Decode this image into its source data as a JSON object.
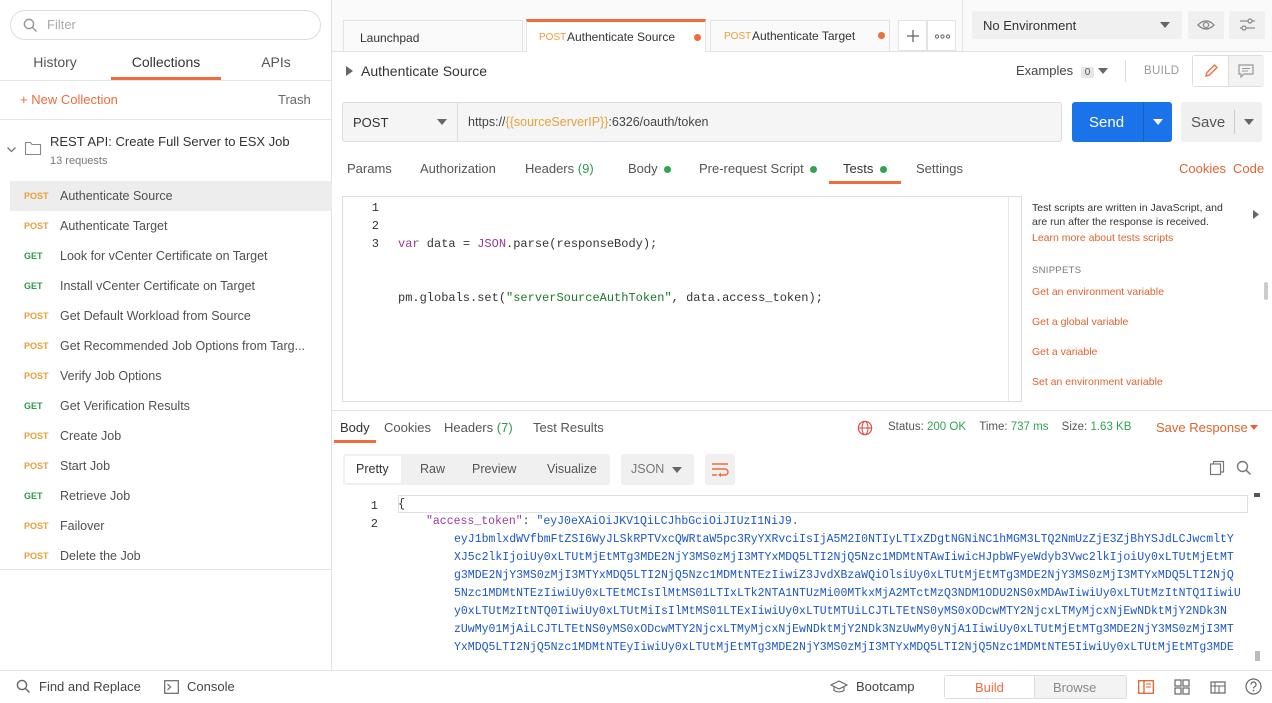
{
  "sidebar": {
    "filter_placeholder": "Filter",
    "tabs": [
      "History",
      "Collections",
      "APIs"
    ],
    "new_collection": "+ New Collection",
    "trash": "Trash",
    "collection": {
      "name": "REST API: Create Full Server to ESX Job",
      "count": "13 requests"
    },
    "requests": [
      {
        "method": "POST",
        "name": "Authenticate Source"
      },
      {
        "method": "POST",
        "name": "Authenticate Target"
      },
      {
        "method": "GET",
        "name": "Look for vCenter Certificate on Target"
      },
      {
        "method": "GET",
        "name": "Install vCenter Certificate on Target"
      },
      {
        "method": "POST",
        "name": "Get Default Workload from Source"
      },
      {
        "method": "POST",
        "name": "Get Recommended Job Options from Targ..."
      },
      {
        "method": "POST",
        "name": "Verify Job Options"
      },
      {
        "method": "GET",
        "name": "Get Verification Results"
      },
      {
        "method": "POST",
        "name": "Create Job"
      },
      {
        "method": "POST",
        "name": "Start Job"
      },
      {
        "method": "GET",
        "name": "Retrieve Job"
      },
      {
        "method": "POST",
        "name": "Failover"
      },
      {
        "method": "POST",
        "name": "Delete the Job"
      }
    ]
  },
  "tabs": {
    "launchpad": "Launchpad",
    "tab1": {
      "method": "POST",
      "name": "Authenticate Source"
    },
    "tab2": {
      "method": "POST",
      "name": "Authenticate Target"
    }
  },
  "environment": {
    "selected": "No Environment"
  },
  "request": {
    "title": "Authenticate Source",
    "examples_label": "Examples",
    "examples_count": "0",
    "build_label": "BUILD",
    "method": "POST",
    "url_prefix": "https://",
    "url_var": "{{sourceServerIP}}",
    "url_suffix": ":6326/oauth/token",
    "send": "Send",
    "save": "Save",
    "tabs": {
      "params": "Params",
      "authorization": "Authorization",
      "headers": "Headers",
      "headers_count": "(9)",
      "body": "Body",
      "prerequest": "Pre-request Script",
      "tests": "Tests",
      "settings": "Settings"
    },
    "cookies": "Cookies",
    "code": "Code"
  },
  "editor": {
    "line_numbers": [
      "1",
      "2",
      "3"
    ],
    "line1": {
      "kw": "var",
      "rest1": " data = ",
      "obj": "JSON",
      "rest2": ".parse(responseBody);"
    },
    "line2": {
      "pre": "pm.globals.set(",
      "str": "\"serverSourceAuthToken\"",
      "post": ", data.access_token);"
    }
  },
  "snippets_panel": {
    "help_line1": "Test scripts are written in JavaScript, and",
    "help_line2": "are run after the response is received.",
    "learn_more": "Learn more about tests scripts",
    "heading": "SNIPPETS",
    "items": [
      "Get an environment variable",
      "Get a global variable",
      "Get a variable",
      "Set an environment variable"
    ]
  },
  "response": {
    "tabs": {
      "body": "Body",
      "cookies": "Cookies",
      "headers": "Headers",
      "headers_count": "(7)",
      "test_results": "Test Results"
    },
    "status_label": "Status:",
    "status_value": "200 OK",
    "time_label": "Time:",
    "time_value": "737 ms",
    "size_label": "Size:",
    "size_value": "1.63 KB",
    "save_response": "Save Response",
    "view_tabs": [
      "Pretty",
      "Raw",
      "Preview",
      "Visualize"
    ],
    "format": "JSON",
    "line_numbers": [
      "1",
      "2"
    ],
    "open_brace": "{",
    "key": "\"access_token\"",
    "colon": ": ",
    "token_lines": [
      "\"eyJ0eXAiOiJKV1QiLCJhbGciOiJIUzI1NiJ9.",
      "eyJ1bmlxdWVfbmFtZSI6WyJLSkRPTVxcQWRtaW5pc3RyYXRvciIsIjA5M2I0NTIyLTIxZDgtNGNiNC1hMGM3LTQ2NmUzZjE3ZjBhYSJdLCJwcmltY",
      "XJ5c2lkIjoiUy0xLTUtMjEtMTg3MDE2NjY3MS0zMjI3MTYxMDQ5LTI2NjQ5Nzc1MDMtNTAwIiwicHJpbWFyeWdyb3Vwc2lkIjoiUy0xLTUtMjEtMT",
      "g3MDE2NjY3MS0zMjI3MTYxMDQ5LTI2NjQ5Nzc1MDMtNTEzIiwiZ3JvdXBzaWQiOlsiUy0xLTUtMjEtMTg3MDE2NjY3MS0zMjI3MTYxMDQ5LTI2NjQ",
      "5Nzc1MDMtNTEzIiwiUy0xLTEtMCIsIlMtMS01LTIxLTk2NTA1NTUzMi00MTkxMjA2MTctMzQ3NDM1ODU2NS0xMDAwIiwiUy0xLTUtMzItNTQ1IiwiU",
      "y0xLTUtMzItNTQ0IiwiUy0xLTUtMiIsIlMtMS01LTExIiwiUy0xLTUtMTUiLCJTLTEtNS0yMS0xODcwMTY2NjcxLTMyMjcxNjEwNDktMjY2NDk3N",
      "zUwMy01MjAiLCJTLTEtNS0yMS0xODcwMTY2NjcxLTMyMjcxNjEwNDktMjY2NDk3NzUwMy0yNjA1IiwiUy0xLTUtMjEtMTg3MDE2NjY3MS0zMjI3MT",
      "YxMDQ5LTI2NjQ5Nzc1MDMtNTEyIiwiUy0xLTUtMjEtMTg3MDE2NjY3MS0zMjI3MTYxMDQ5LTI2NjQ5Nzc1MDMtNTE5IiwiUy0xLTUtMjEtMTg3MDE"
    ]
  },
  "footer": {
    "find_replace": "Find and Replace",
    "console": "Console",
    "bootcamp": "Bootcamp",
    "build": "Build",
    "browse": "Browse"
  },
  "colors": {
    "accent": "#f26b3a",
    "send": "#1a73e8",
    "post": "#e8a03a",
    "get": "#2f9a4b",
    "ok": "#2fa44f"
  }
}
